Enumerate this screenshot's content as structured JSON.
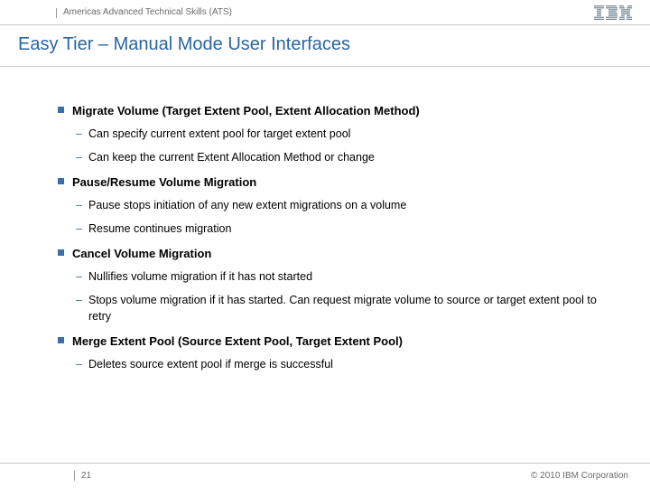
{
  "header": {
    "org": "Americas Advanced Technical Skills (ATS)",
    "logo_name": "IBM"
  },
  "title": "Easy Tier – Manual Mode User Interfaces",
  "items": [
    {
      "head": "Migrate Volume (Target Extent Pool, Extent Allocation Method)",
      "subs": [
        "Can specify current extent pool for target extent pool",
        "Can keep the current Extent Allocation Method or change"
      ]
    },
    {
      "head": "Pause/Resume Volume Migration",
      "subs": [
        "Pause stops initiation of any new extent migrations on a volume",
        "Resume continues migration"
      ]
    },
    {
      "head": "Cancel Volume Migration",
      "subs": [
        "Nullifies volume migration if it has not started",
        "Stops volume migration if it has started. Can request migrate volume to source or target extent pool to retry"
      ]
    },
    {
      "head": "Merge Extent Pool (Source Extent Pool, Target Extent Pool)",
      "subs": [
        "Deletes source extent pool if merge is successful"
      ]
    }
  ],
  "footer": {
    "page": "21",
    "copyright": "© 2010 IBM Corporation"
  }
}
